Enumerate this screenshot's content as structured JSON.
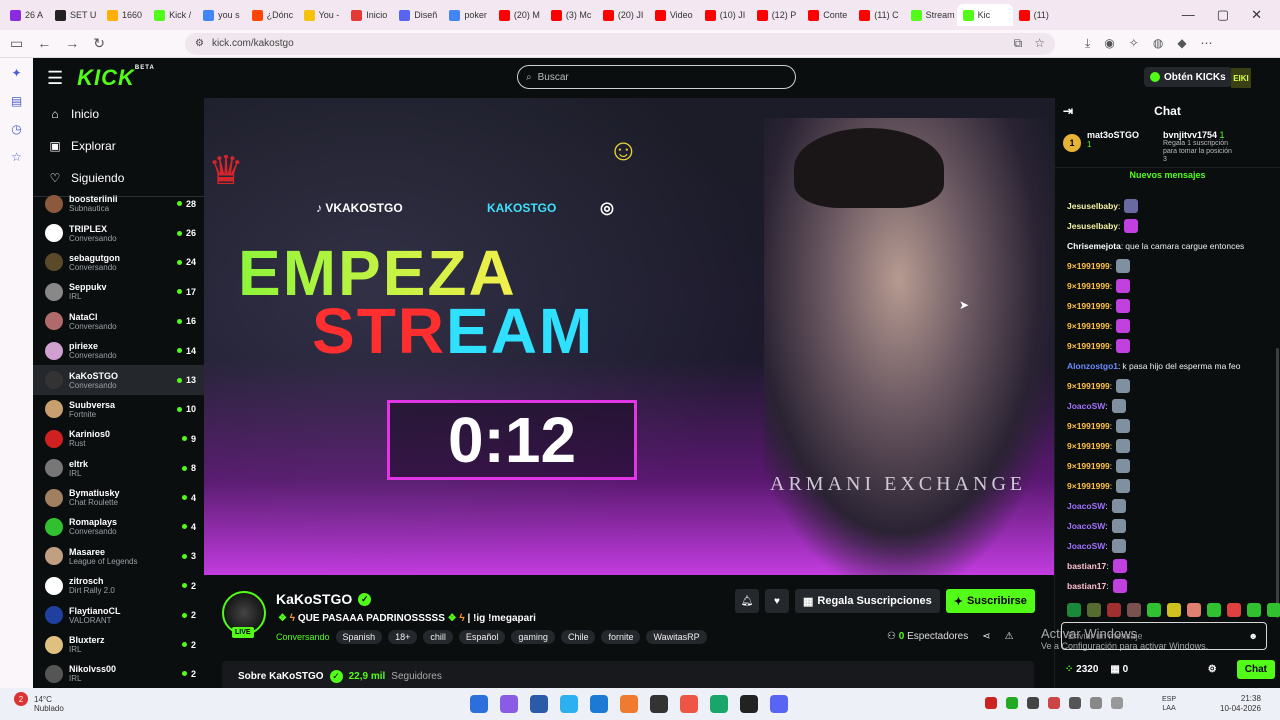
{
  "browser": {
    "tabs": [
      {
        "label": "26 A",
        "color": "#8a2be2"
      },
      {
        "label": "SET U",
        "color": "#222222"
      },
      {
        "label": "1660",
        "color": "#ffb000"
      },
      {
        "label": "Kick /",
        "color": "#53fc18"
      },
      {
        "label": "you s",
        "color": "#4285f4"
      },
      {
        "label": "¿Dónc",
        "color": "#ff4500"
      },
      {
        "label": "You -",
        "color": "#f4c20d"
      },
      {
        "label": "Inicio",
        "color": "#e53935"
      },
      {
        "label": "Diseñ",
        "color": "#5865f2"
      },
      {
        "label": "poker",
        "color": "#4285f4"
      },
      {
        "label": "(20) M",
        "color": "#ff0000"
      },
      {
        "label": "(3) Mc",
        "color": "#ff0000"
      },
      {
        "label": "(20) JI",
        "color": "#ff0000"
      },
      {
        "label": "Video",
        "color": "#ff0000"
      },
      {
        "label": "(10) JI",
        "color": "#ff0000"
      },
      {
        "label": "(12) P",
        "color": "#ff0000"
      },
      {
        "label": "Conte",
        "color": "#ff0000"
      },
      {
        "label": "(11) C",
        "color": "#ff0000"
      },
      {
        "label": "Stream",
        "color": "#53fc18"
      },
      {
        "label": "Kic",
        "color": "#53fc18",
        "active": true
      },
      {
        "label": "(11)",
        "color": "#ff0000"
      }
    ],
    "url": "kick.com/kakostgo"
  },
  "header": {
    "logo": "KICK",
    "logo_badge": "BETA",
    "search_placeholder": "Buscar",
    "kicks_button": "Obtén KICKs",
    "avatar": "EIKI"
  },
  "nav": {
    "inicio": "Inicio",
    "explorar": "Explorar",
    "siguiendo": "Siguiendo"
  },
  "following": [
    {
      "name": "boosteriinii",
      "category": "Subnautica",
      "viewers": "28",
      "color": "#8b5a3c"
    },
    {
      "name": "TRIPLEX",
      "category": "Conversando",
      "viewers": "26",
      "color": "#ffffff"
    },
    {
      "name": "sebagutgon",
      "category": "Conversando",
      "viewers": "24",
      "color": "#5a4a2a"
    },
    {
      "name": "Seppukv",
      "category": "IRL",
      "viewers": "17",
      "color": "#888888"
    },
    {
      "name": "NataCl",
      "category": "Conversando",
      "viewers": "16",
      "color": "#b06a6a"
    },
    {
      "name": "piriexe",
      "category": "Conversando",
      "viewers": "14",
      "color": "#d0a0d0"
    },
    {
      "name": "KaKoSTGO",
      "category": "Conversando",
      "viewers": "13",
      "color": "#333333",
      "selected": true
    },
    {
      "name": "Suubversa",
      "category": "Fortnite",
      "viewers": "10",
      "color": "#c8a070"
    },
    {
      "name": "Karinios0",
      "category": "Rust",
      "viewers": "9",
      "color": "#d02020"
    },
    {
      "name": "eltrk",
      "category": "IRL",
      "viewers": "8",
      "color": "#777777"
    },
    {
      "name": "Bymatiusky",
      "category": "Chat Roulette",
      "viewers": "4",
      "color": "#a08060"
    },
    {
      "name": "Romaplays",
      "category": "Conversando",
      "viewers": "4",
      "color": "#30c030"
    },
    {
      "name": "Masaree",
      "category": "League of Legends",
      "viewers": "3",
      "color": "#c0a080"
    },
    {
      "name": "zitrosch",
      "category": "Dirt Rally 2.0",
      "viewers": "2",
      "color": "#ffffff"
    },
    {
      "name": "FlaytianoCL",
      "category": "VALORANT",
      "viewers": "2",
      "color": "#2040a0"
    },
    {
      "name": "Bluxterz",
      "category": "IRL",
      "viewers": "2",
      "color": "#e0c080"
    },
    {
      "name": "Nikolvss00",
      "category": "IRL",
      "viewers": "2",
      "color": "#555555"
    }
  ],
  "video": {
    "tiktok": "VKAKOSTGO",
    "instagram_handle": "KAKOSTGO",
    "line1": "EMPEZA",
    "line2a": "STR",
    "line2b": "EAM",
    "timer": "0:12",
    "shirt": "ARMANI EXCHANGE"
  },
  "stream": {
    "channel": "KaKoSTGO",
    "live": "LIVE",
    "title": "QUE PASAAA PADRINOSSSSS",
    "command": "| !ig !megapari",
    "category": "Conversando",
    "tags": [
      "Spanish",
      "18+",
      "chill",
      "Español",
      "gaming",
      "Chile",
      "fornite",
      "WawitasRP"
    ],
    "gift_button": "Regala Suscripciones",
    "subscribe_button": "Suscribirse",
    "viewers_count": "0",
    "viewers_label": "Espectadores",
    "about_title": "Sobre KaKoSTGO",
    "followers": "22,9 mil",
    "followers_label": "Seguidores"
  },
  "chat": {
    "title": "Chat",
    "pinned_user1": "mat3oSTGO",
    "pinned_user1_count": "1",
    "pinned_rank": "1",
    "pinned_user2": "bvnjitvv1754",
    "pinned_user2_count": "1",
    "pinned_user2_text": "Regala 1 suscripción para tomar la posición 3",
    "new_messages": "Nuevos mensajes",
    "messages": [
      {
        "user": "Jesuselbaby",
        "color": "#f4f4a0",
        "emote": "#6a6aa0"
      },
      {
        "user": "Jesuselbaby",
        "color": "#f4f4a0",
        "emote": "#c040e0"
      },
      {
        "user": "Chrisemejota",
        "color": "#ffffff",
        "text": "que la camara cargue entonces"
      },
      {
        "user": "9×1991999",
        "color": "#ffc040",
        "emote": "#8090a0"
      },
      {
        "user": "9×1991999",
        "color": "#ffc040",
        "emote": "#c040e0"
      },
      {
        "user": "9×1991999",
        "color": "#ffc040",
        "emote": "#c040e0"
      },
      {
        "user": "9×1991999",
        "color": "#ffc040",
        "emote": "#c040e0"
      },
      {
        "user": "9×1991999",
        "color": "#ffc040",
        "emote": "#c040e0"
      },
      {
        "user": "Alonzostgo1",
        "color": "#6a8cff",
        "text": "k pasa hijo del esperma ma feo"
      },
      {
        "user": "9×1991999",
        "color": "#ffc040",
        "emote": "#8090a0"
      },
      {
        "user": "JoacoSW",
        "color": "#a070ff",
        "emote": "#8090a0"
      },
      {
        "user": "9×1991999",
        "color": "#ffc040",
        "emote": "#8090a0"
      },
      {
        "user": "9×1991999",
        "color": "#ffc040",
        "emote": "#8090a0"
      },
      {
        "user": "9×1991999",
        "color": "#ffc040",
        "emote": "#8090a0"
      },
      {
        "user": "9×1991999",
        "color": "#ffc040",
        "emote": "#8090a0"
      },
      {
        "user": "JoacoSW",
        "color": "#a070ff",
        "emote": "#8090a0"
      },
      {
        "user": "JoacoSW",
        "color": "#a070ff",
        "emote": "#8090a0"
      },
      {
        "user": "JoacoSW",
        "color": "#a070ff",
        "emote": "#8090a0"
      },
      {
        "user": "bastian17",
        "color": "#ffc0d0",
        "emote": "#c040e0"
      },
      {
        "user": "bastian17",
        "color": "#ffc0d0",
        "emote": "#c040e0"
      }
    ],
    "emote_bar": [
      "#1a8a3a",
      "#556b2f",
      "#a03030",
      "#7a5050",
      "#30c030",
      "#d0c020",
      "#e08070",
      "#30c030",
      "#e04040",
      "#30c030",
      "#30c030"
    ],
    "input_placeholder": "Enviar un mensaje",
    "kicks": "2320",
    "gifts": "0",
    "send_button": "Chat"
  },
  "windows_watermark": {
    "title": "Activar Windows",
    "subtitle": "Ve a Configuración para activar Windows."
  },
  "taskbar": {
    "notif_count": "2",
    "temperature": "14°C",
    "weather": "Nublado",
    "lang1": "ESP",
    "lang2": "LAA",
    "time": "21:38",
    "date": "10-04-2026"
  }
}
